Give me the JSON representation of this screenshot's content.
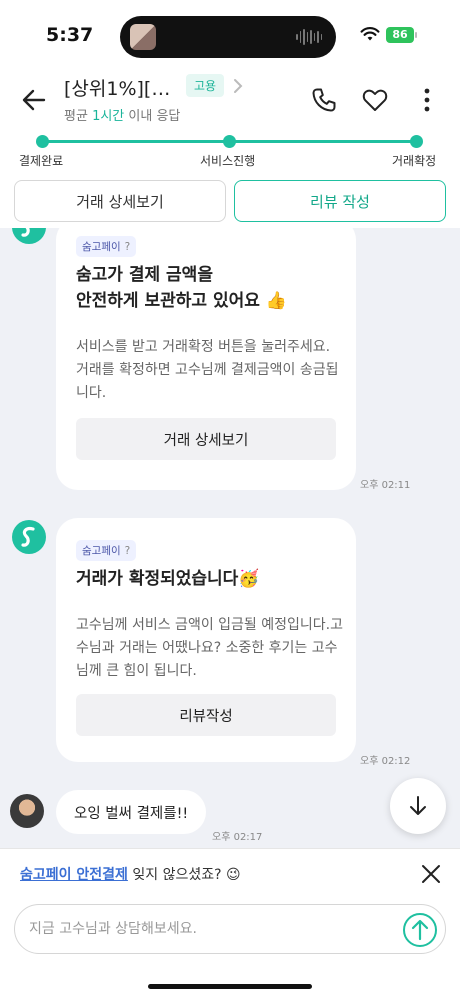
{
  "status_bar": {
    "time": "5:37",
    "battery": "86"
  },
  "header": {
    "title": "[상위1%][…",
    "badge": "고용",
    "subtitle_prefix": "평균 ",
    "subtitle_accent": "1시간",
    "subtitle_suffix": " 이내 응답"
  },
  "progress": {
    "steps": [
      "결제완료",
      "서비스진행",
      "거래확정"
    ]
  },
  "actions": {
    "details_label": "거래 상세보기",
    "review_label": "리뷰 작성"
  },
  "messages": [
    {
      "tag": "숨고페이",
      "tag_help": "?",
      "title_line1": "숨고가 결제 금액을",
      "title_line2": "안전하게 보관하고 있어요 👍",
      "body": "서비스를 받고 거래확정 버튼을 눌러주세요. 거래를 확정하면 고수님께 결제금액이 송금됩니다.",
      "button": "거래 상세보기",
      "time": "오후 02:11"
    },
    {
      "tag": "숨고페이",
      "tag_help": "?",
      "title_line1": "거래가 확정되었습니다🥳",
      "body": "고수님께 서비스 금액이 입금될 예정입니다.고수님과 거래는 어땠나요? 소중한 후기는 고수님께 큰 힘이 됩니다.",
      "button": "리뷰작성",
      "time": "오후 02:12"
    }
  ],
  "user_message": {
    "text": "오잉 벌써 결제를!!",
    "time": "오후 02:17"
  },
  "banner": {
    "link_text": "숨고페이 안전결제",
    "rest_text": " 잊지 않으셨죠? 😉"
  },
  "composer": {
    "placeholder": "지금 고수님과 상담해보세요."
  },
  "colors": {
    "accent": "#1fc0a0",
    "link": "#3b6fd4",
    "chat_bg": "#eff1f6"
  }
}
